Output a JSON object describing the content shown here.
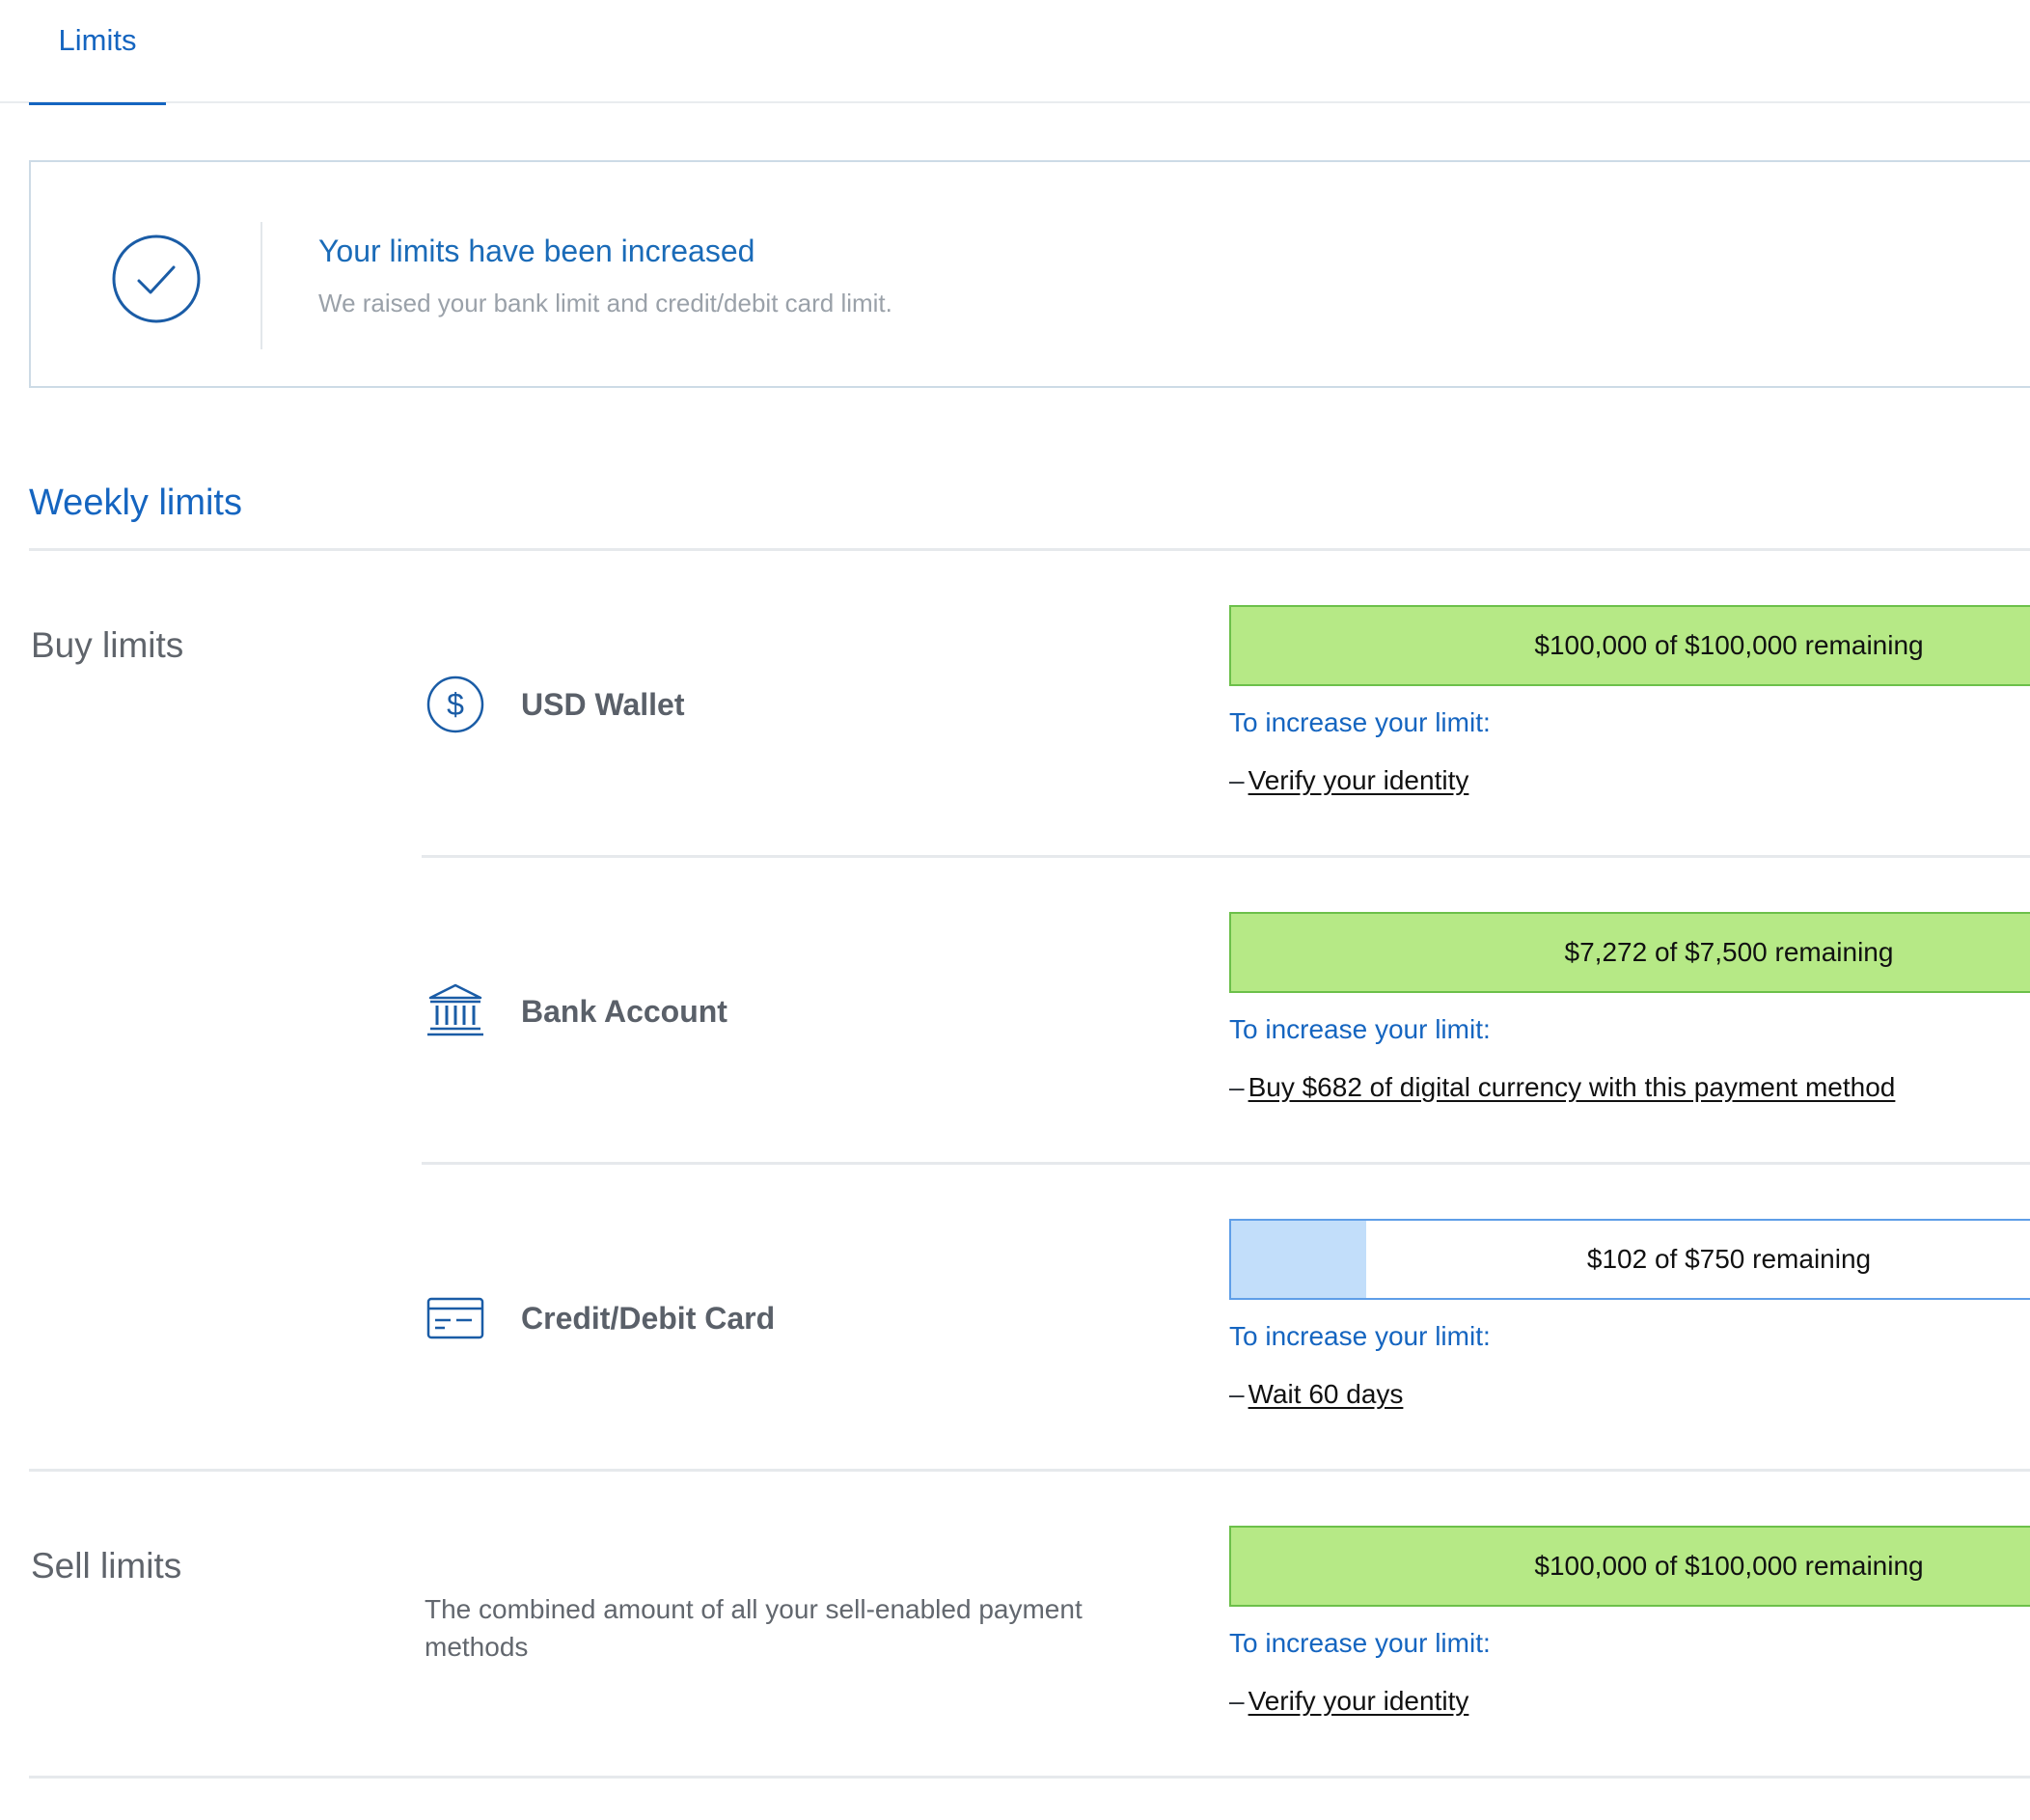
{
  "tabs": [
    {
      "label": "Limits",
      "active": true
    }
  ],
  "notice": {
    "title": "Your limits have been increased",
    "message": "We raised your bank limit and credit/debit card limit.",
    "icon": "check-circle-icon"
  },
  "weekly": {
    "title": "Weekly limits",
    "buy": {
      "label": "Buy limits",
      "methods": [
        {
          "name": "USD Wallet",
          "icon": "dollar-circle-icon",
          "remaining_text": "$100,000 of $100,000 remaining",
          "remaining_fraction": 1.0,
          "increase_label": "To increase your limit:",
          "dash": "–",
          "requirement": "Verify your identity"
        },
        {
          "name": "Bank Account",
          "icon": "bank-icon",
          "remaining_text": "$7,272 of $7,500 remaining",
          "remaining_fraction": 0.97,
          "increase_label": "To increase your limit:",
          "dash": "–",
          "requirement": "Buy $682 of digital currency with this payment method"
        },
        {
          "name": "Credit/Debit Card",
          "icon": "credit-card-icon",
          "remaining_text": "$102 of $750 remaining",
          "remaining_fraction": 0.136,
          "increase_label": "To increase your limit:",
          "dash": "–",
          "requirement": "Wait 60 days"
        }
      ]
    },
    "sell": {
      "label": "Sell limits",
      "description": "The combined amount of all your sell-enabled payment methods",
      "remaining_text": "$100,000 of $100,000 remaining",
      "remaining_fraction": 1.0,
      "increase_label": "To increase your limit:",
      "dash": "–",
      "requirement": "Verify your identity"
    }
  },
  "colors": {
    "accent": "#1565c0",
    "full_bar": "#b6e986",
    "full_bar_border": "#6cc04a",
    "partial_fill": "#c2defa",
    "partial_border": "#5f9ee8"
  }
}
